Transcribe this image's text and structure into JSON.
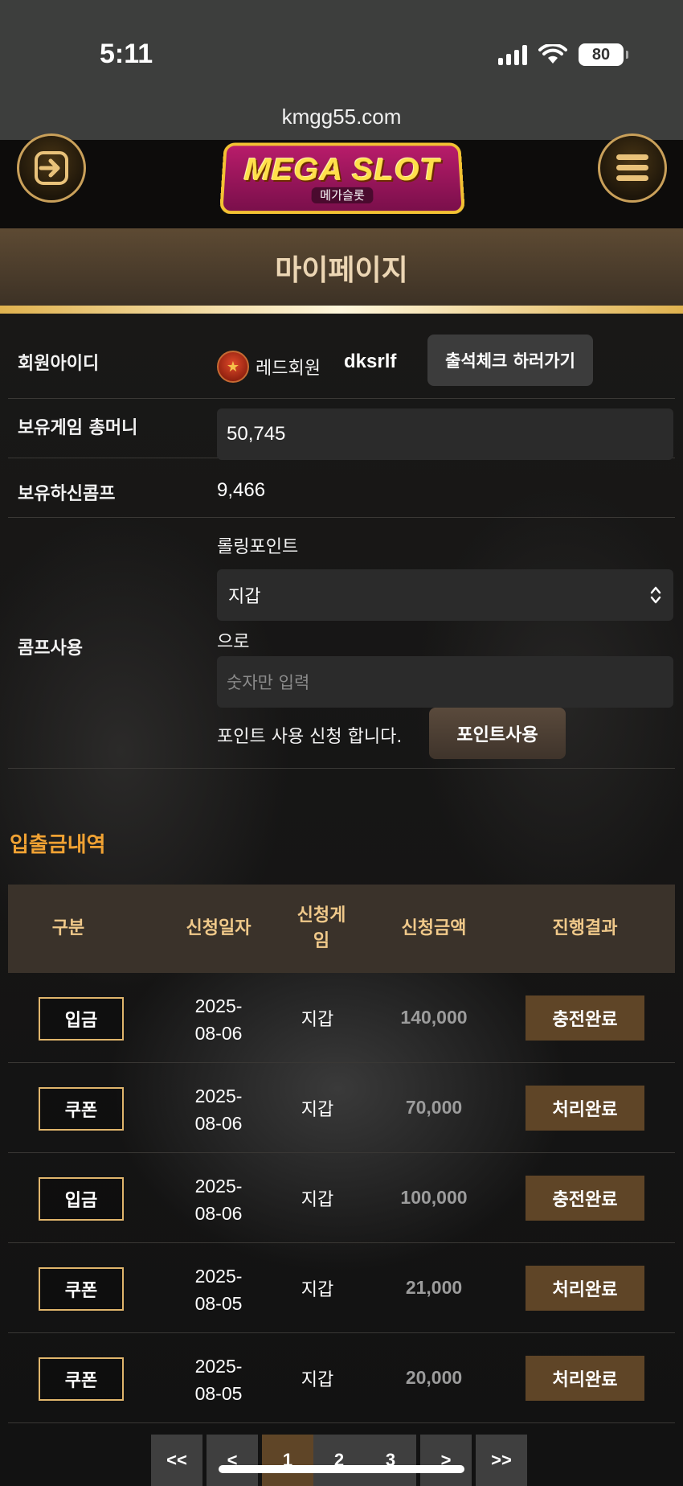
{
  "status_bar": {
    "time": "5:11",
    "battery": "80"
  },
  "browser": {
    "url": "kmgg55.com"
  },
  "header": {
    "logo_main": "MEGA SLOT",
    "logo_sub": "메가슬롯"
  },
  "page": {
    "title": "마이페이지"
  },
  "member": {
    "id_label": "회원아이디",
    "grade": "레드회원",
    "user_id": "dksrlf",
    "checkin_button": "출석체크 하러가기"
  },
  "money": {
    "label": "보유게임 총머니",
    "value": "50,745"
  },
  "comp": {
    "label": "보유하신콤프",
    "value": "9,466"
  },
  "comp_use": {
    "label": "콤프사용",
    "rolling_label": "롤링포인트",
    "select_value": "지갑",
    "to_label": "으로",
    "amount_placeholder": "숫자만 입력",
    "request_text": "포인트 사용 신청 합니다.",
    "button": "포인트사용"
  },
  "history": {
    "title": "입출금내역",
    "headers": [
      "구분",
      "신청일자",
      "신청게\n임",
      "신청금액",
      "진행결과"
    ],
    "rows": [
      {
        "type": "입금",
        "date": "2025-\n08-06",
        "game": "지갑",
        "amount": "140,000",
        "result": "충전완료"
      },
      {
        "type": "쿠폰",
        "date": "2025-\n08-06",
        "game": "지갑",
        "amount": "70,000",
        "result": "처리완료"
      },
      {
        "type": "입금",
        "date": "2025-\n08-06",
        "game": "지갑",
        "amount": "100,000",
        "result": "충전완료"
      },
      {
        "type": "쿠폰",
        "date": "2025-\n08-05",
        "game": "지갑",
        "amount": "21,000",
        "result": "처리완료"
      },
      {
        "type": "쿠폰",
        "date": "2025-\n08-05",
        "game": "지갑",
        "amount": "20,000",
        "result": "처리완료"
      }
    ]
  },
  "pagination": {
    "first": "<<",
    "prev": "<",
    "pages": [
      "1",
      "2",
      "3"
    ],
    "active_page": "1",
    "next": ">",
    "last": ">>"
  },
  "colors": {
    "accent_gold": "#e0b24f",
    "section_orange": "#f1a233",
    "result_brown": "#5f4527",
    "header_text": "#f0c98a"
  }
}
